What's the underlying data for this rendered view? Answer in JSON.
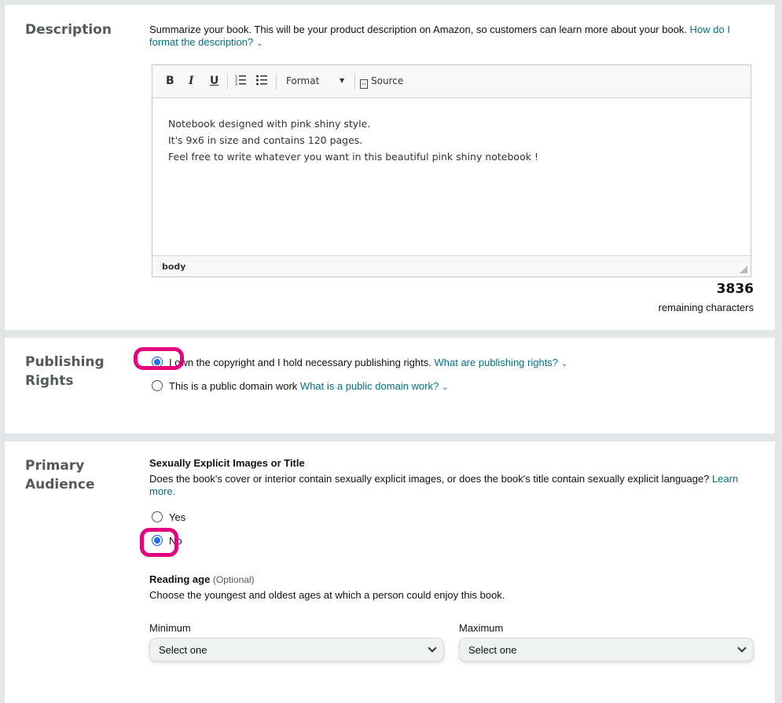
{
  "description": {
    "title": "Description",
    "helper": "Summarize your book. This will be your product description on Amazon, so customers can learn more about your book.",
    "helper_link": "How do I format the description?",
    "toolbar": {
      "bold": "B",
      "italic": "I",
      "underline": "U",
      "format": "Format",
      "source": "Source"
    },
    "body_lines": [
      "Notebook designed with pink shiny style.",
      "It's 9x6 in size and contains 120 pages.",
      "Feel free to write whatever you want in this beautiful pink shiny notebook !"
    ],
    "footer_path": "body",
    "remaining_count": "3836",
    "remaining_label": "remaining characters"
  },
  "publishing_rights": {
    "title": "Publishing Rights",
    "options": [
      {
        "label": "I own the copyright and I hold necessary publishing rights.",
        "link": "What are publishing rights?",
        "selected": true
      },
      {
        "label": "This is a public domain work",
        "link": "What is a public domain work?",
        "selected": false
      }
    ]
  },
  "primary_audience": {
    "title": "Primary Audience",
    "explicit_heading": "Sexually Explicit Images or Title",
    "explicit_question": "Does the book's cover or interior contain sexually explicit images, or does the book's title contain sexually explicit language?",
    "learn_more": "Learn more.",
    "options": [
      {
        "label": "Yes",
        "selected": false
      },
      {
        "label": "No",
        "selected": true
      }
    ],
    "reading_age_label": "Reading age",
    "reading_age_optional": "(Optional)",
    "reading_age_help": "Choose the youngest and oldest ages at which a person could enjoy this book.",
    "minimum_label": "Minimum",
    "minimum_value": "Select one",
    "maximum_label": "Maximum",
    "maximum_value": "Select one"
  },
  "colors": {
    "accent_link": "#007185",
    "highlight": "#e5007e",
    "radio_selected": "#1a73e8"
  }
}
